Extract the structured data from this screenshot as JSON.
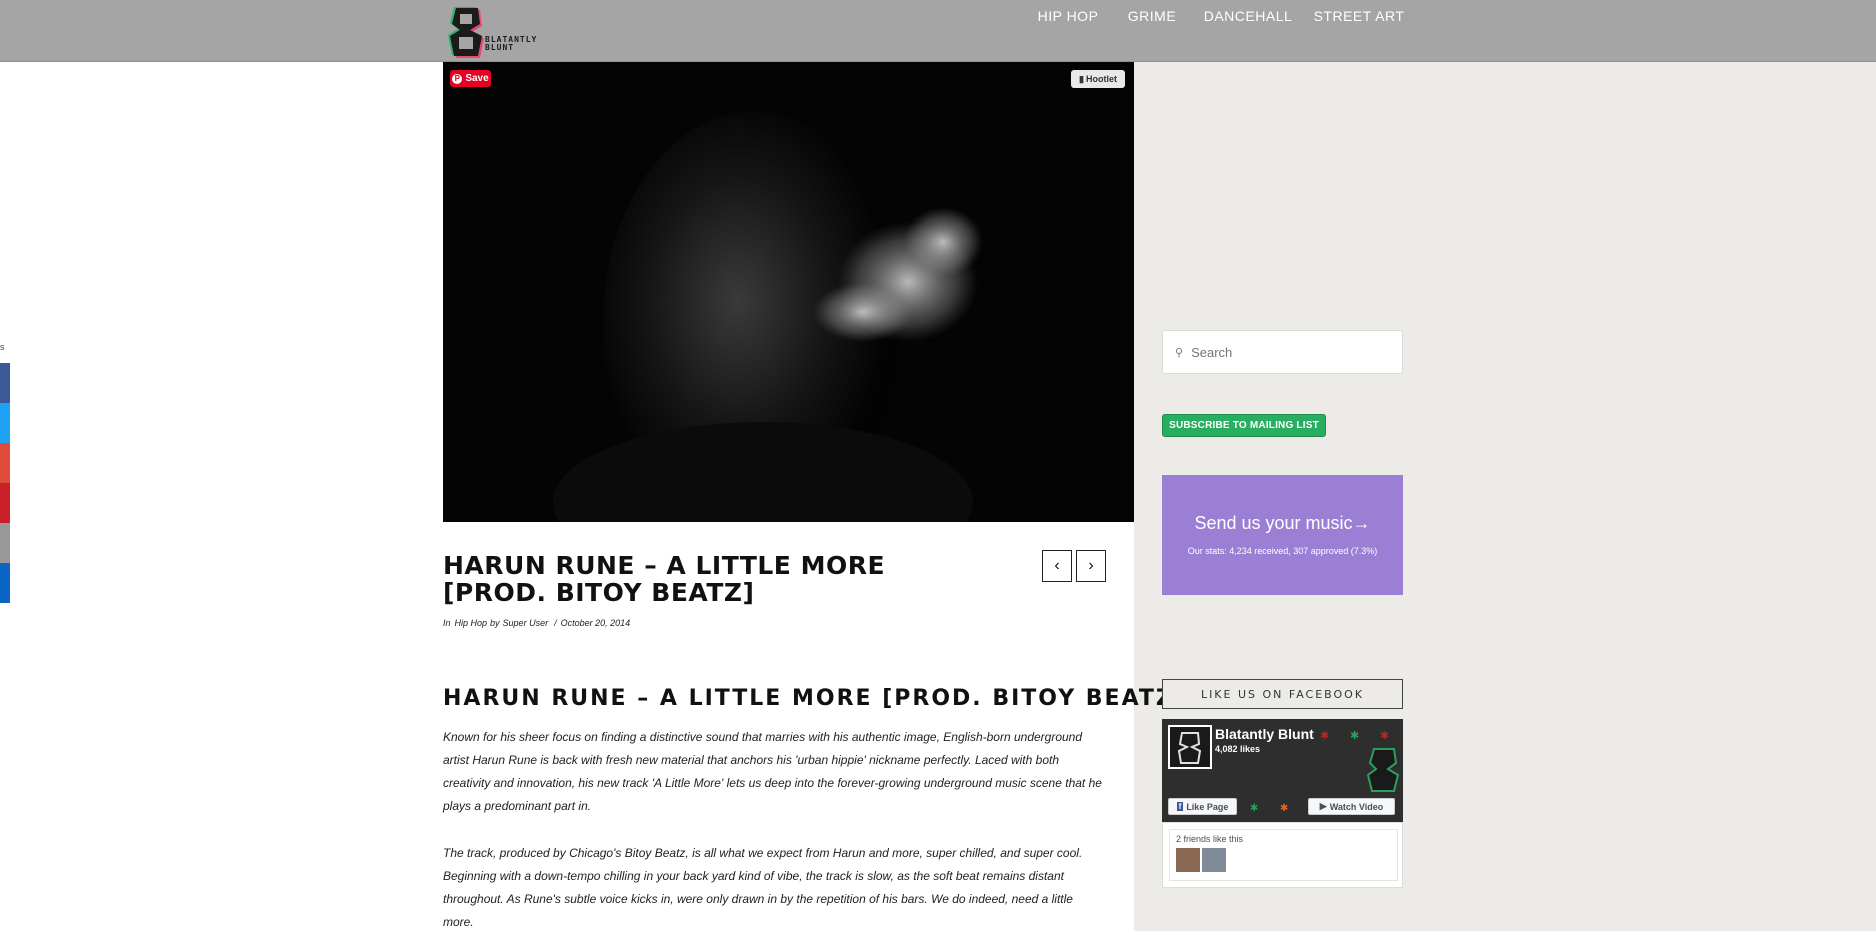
{
  "header": {
    "logo_text_line1": "BLATANTLY",
    "logo_text_line2": "BLUNT",
    "nav": [
      {
        "label": "HIP HOP",
        "color": "#8cc63f"
      },
      {
        "label": "GRIME",
        "color": "#e57373"
      },
      {
        "label": "DANCEHALL",
        "color": "#f26522"
      },
      {
        "label": "STREET ART",
        "color": "#26a69a"
      }
    ]
  },
  "share": {
    "count_label": "s",
    "colors": [
      "#3b5998",
      "#1da1f2",
      "#dd4b39",
      "#cb2027",
      "#999999",
      "#0a66c2"
    ]
  },
  "hero": {
    "pin_label": "Save",
    "hootlet_label": "Hootlet"
  },
  "post": {
    "title": "HARUN RUNE – A LITTLE MORE [PROD. BITOY BEATZ]",
    "meta_in": "In",
    "category": "Hip Hop",
    "meta_by": "by",
    "author": "Super User",
    "date": "October 20, 2014",
    "subtitle": "HARUN RUNE – A LITTLE MORE [PROD. BITOY BEATZ]",
    "paragraph1": "Known for his sheer focus on finding a distinctive sound that marries with his authentic image, English-born underground artist Harun Rune is back with fresh new material that anchors his 'urban hippie' nickname perfectly. Laced with both creativity and innovation, his new track 'A Little More' lets us deep into the  forever-growing underground music scene that he plays a predominant part in.",
    "paragraph2": "The track, produced by Chicago's Bitoy Beatz, is all what we expect from Harun and more, super chilled, and super cool. Beginning with a down-tempo chilling in your back yard kind of vibe, the track is slow, as the soft beat remains distant throughout. As Rune's subtle voice kicks in, were only drawn in by the repetition  of his bars. We do indeed, need a little more."
  },
  "sidebar": {
    "search_placeholder": "Search",
    "subscribe_label": "SUBSCRIBE TO MAILING LIST",
    "send_title": "Send us your music→",
    "send_stats": "Our stats: 4,234 received, 307 approved (7.3%)",
    "facebook_heading": "LIKE US ON FACEBOOK",
    "fb_page_name": "Blatantly Blunt",
    "fb_likes": "4,082 likes",
    "fb_like_button": "Like Page",
    "fb_watch_button": "Watch Video",
    "fb_friends_text": "2 friends like this"
  }
}
